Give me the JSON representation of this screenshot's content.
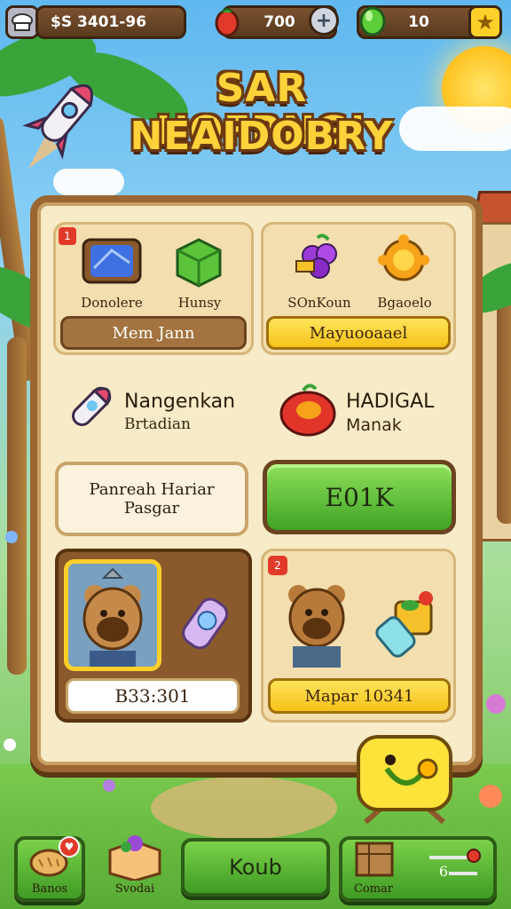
{
  "hud": {
    "coins_icon": "chef-hat-icon",
    "coins_value": "$S 3401-96",
    "gems_icon": "chili-icon",
    "gems_value": "700",
    "gems_add_icon": "plus-icon",
    "leaf_icon": "green-gem-icon",
    "leaf_value": "10",
    "star_icon": "star-icon"
  },
  "title": {
    "line1": "SAR HOFRNG!",
    "line2": "NEAIDOBRY"
  },
  "board": {
    "top_left": {
      "badge": "1",
      "items": [
        {
          "icon": "blue-crate-icon",
          "label": "Donolere"
        },
        {
          "icon": "green-cube-icon",
          "label": "Hunsy"
        }
      ],
      "button_label": "Mem Jann"
    },
    "top_right": {
      "items": [
        {
          "icon": "grapes-icon",
          "label": "SOnKoun"
        },
        {
          "icon": "sun-gear-icon",
          "label": "Bgaoelo"
        }
      ],
      "button_label": "Mayuooaael"
    },
    "middle_left": {
      "icon": "rocket-icon",
      "title": "Nangenkan",
      "subtitle": "Brtadian"
    },
    "middle_right": {
      "icon": "apple-icon",
      "title": "HADIGAL",
      "subtitle": "Manak"
    },
    "info_box": {
      "line1": "Panreah Hariar",
      "line2": "Pasgar"
    },
    "action_button": "E01K",
    "bottom_left": {
      "portrait_icon": "bear-chef-portrait",
      "item_icon": "crystal-bottle-icon",
      "price_label": "B33:301"
    },
    "bottom_right": {
      "badge": "2",
      "portrait_icon": "bear-worker-portrait",
      "item_icon": "potion-bundle-icon",
      "price_label": "Mapar 10341"
    }
  },
  "mascot_icon": "yellow-banana-mascot",
  "nav": {
    "items": [
      {
        "icon": "bread-icon",
        "label": "Banos",
        "badge_icon": "heart-badge-icon"
      },
      {
        "icon": "bakery-box-icon",
        "label": "Svodai"
      },
      {
        "label": "Koub"
      },
      {
        "icon": "crate-icon",
        "label": "Comar"
      },
      {
        "icon": "key-icon",
        "label": "6"
      }
    ]
  },
  "colors": {
    "accent_yellow": "#ffd23a",
    "wood": "#9a6632",
    "green_button": "#4fb82f",
    "board_paper": "#f7ebc8"
  }
}
